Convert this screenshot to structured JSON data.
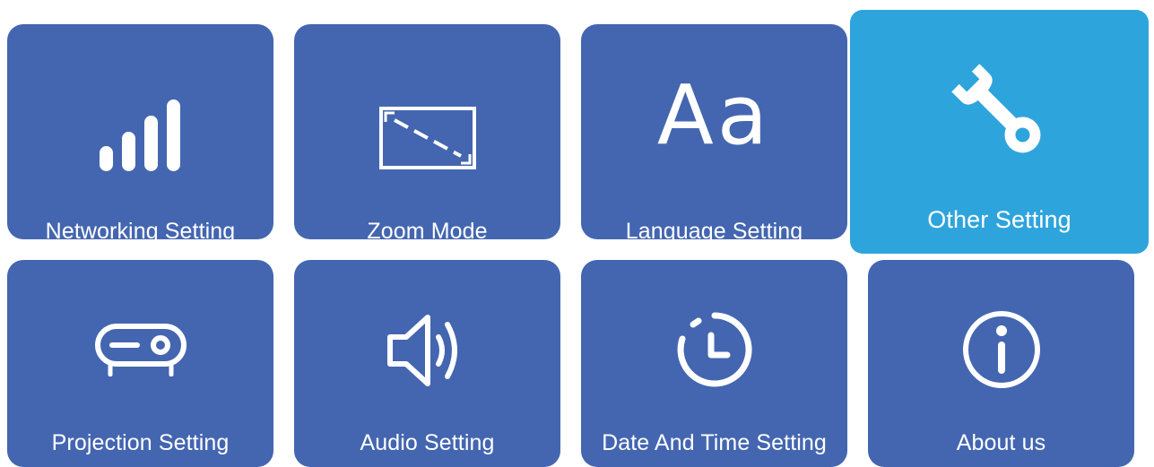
{
  "menu": {
    "tiles": [
      {
        "label": "Networking Setting",
        "icon": "signal-bars-icon",
        "selected": false
      },
      {
        "label": "Zoom Mode",
        "icon": "zoom-frame-icon",
        "selected": false
      },
      {
        "label": "Language Setting",
        "icon": "font-aa-icon",
        "icon_text": "Aa",
        "selected": false
      },
      {
        "label": "Other Setting",
        "icon": "wrench-icon",
        "selected": true
      },
      {
        "label": "Projection Setting",
        "icon": "projector-icon",
        "selected": false
      },
      {
        "label": "Audio Setting",
        "icon": "speaker-icon",
        "selected": false
      },
      {
        "label": "Date And Time Setting",
        "icon": "clock-icon",
        "selected": false
      },
      {
        "label": "About us",
        "icon": "info-icon",
        "selected": false
      }
    ]
  },
  "colors": {
    "tile": "#4466b0",
    "tile_selected": "#2ea4dc",
    "text": "#ffffff",
    "background": "#ffffff"
  }
}
